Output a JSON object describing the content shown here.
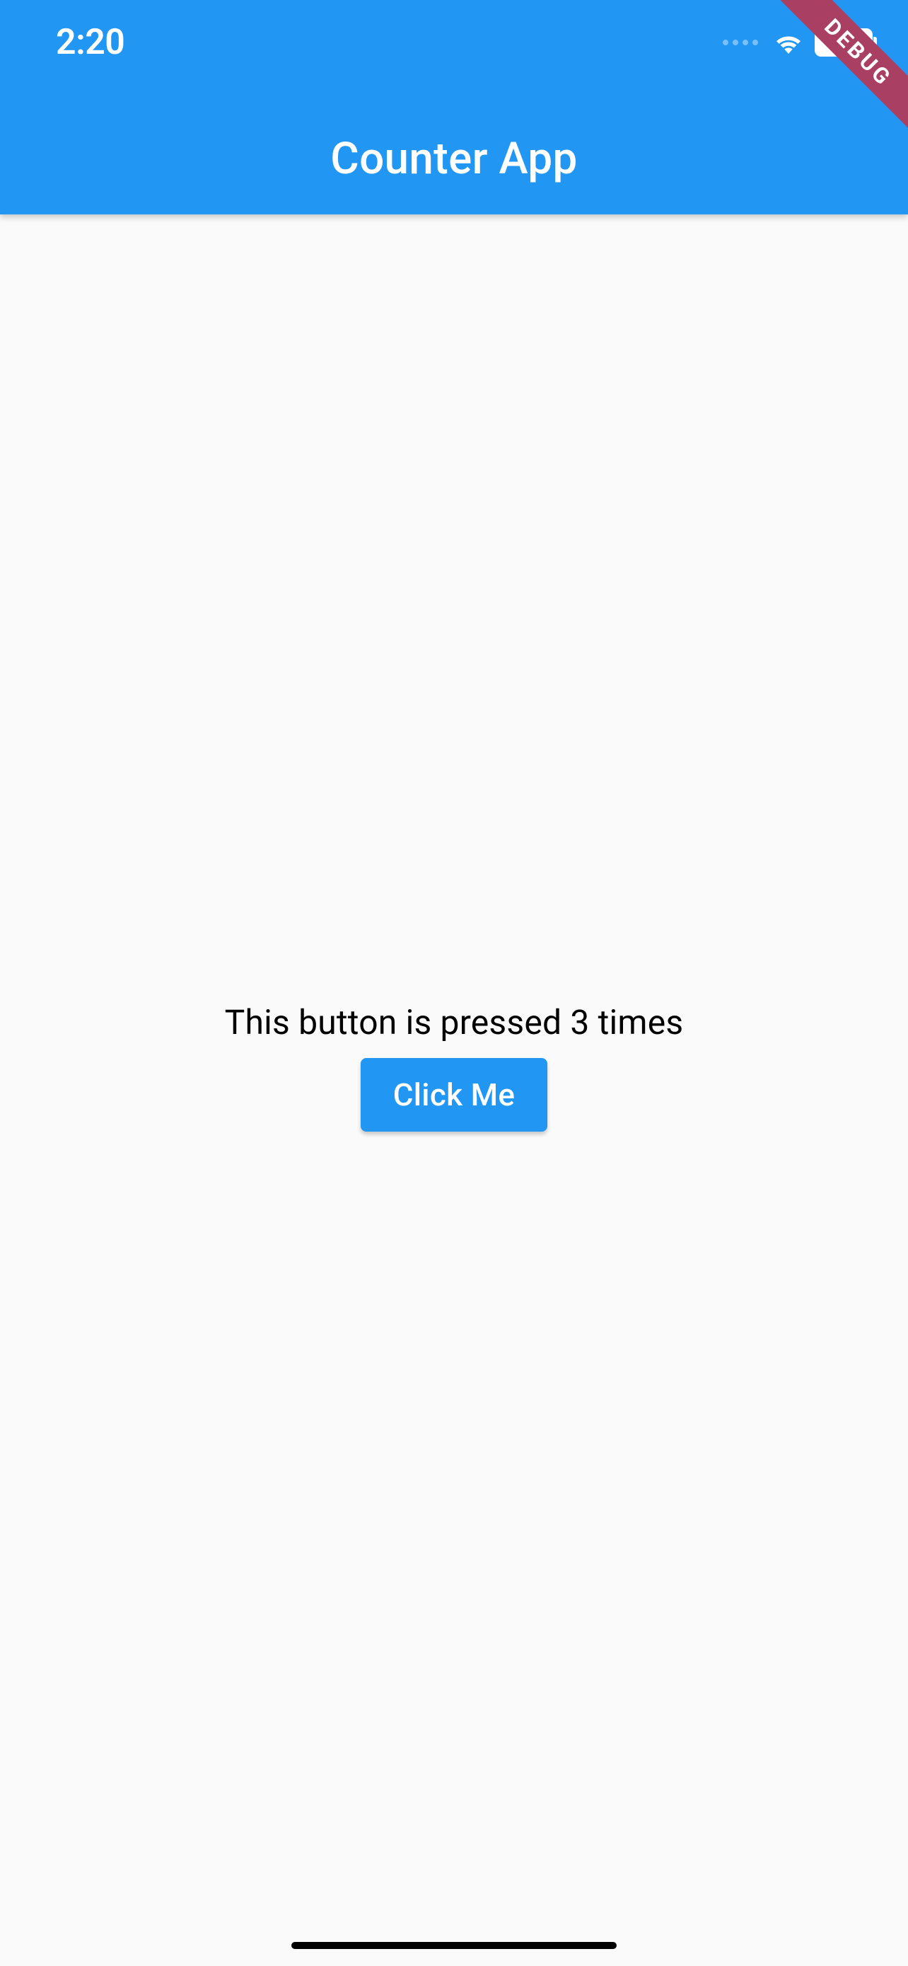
{
  "statusBar": {
    "time": "2:20"
  },
  "debugBanner": {
    "label": "DEBUG"
  },
  "appBar": {
    "title": "Counter App"
  },
  "content": {
    "counterText": "This button is pressed 3 times",
    "buttonLabel": "Click Me"
  }
}
